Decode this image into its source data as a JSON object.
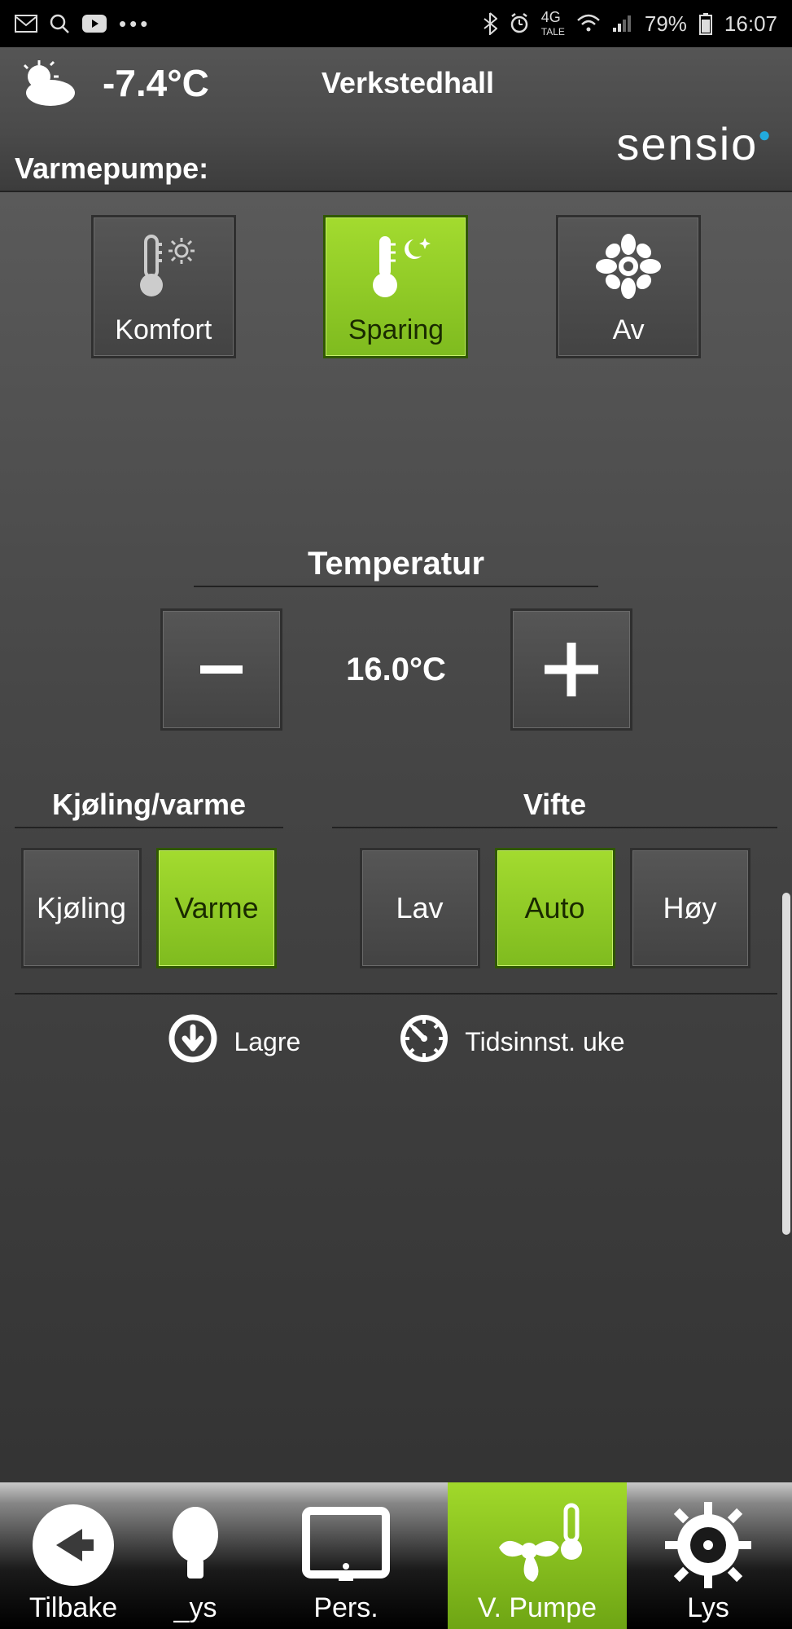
{
  "status": {
    "battery": "79%",
    "time": "16:07",
    "network_label": "4G",
    "network_sub": "TALE"
  },
  "header": {
    "outside_temp": "-7.4°C",
    "room_name": "Verkstedhall",
    "brand": "sensio",
    "section_title": "Varmepumpe:"
  },
  "modes": {
    "items": [
      {
        "label": "Komfort",
        "active": false
      },
      {
        "label": "Sparing",
        "active": true
      },
      {
        "label": "Av",
        "active": false
      }
    ]
  },
  "temperature": {
    "title": "Temperatur",
    "value": "16.0°C"
  },
  "heat_cool": {
    "title": "Kjøling/varme",
    "options": [
      {
        "label": "Kjøling",
        "active": false
      },
      {
        "label": "Varme",
        "active": true
      }
    ]
  },
  "fan": {
    "title": "Vifte",
    "options": [
      {
        "label": "Lav",
        "active": false
      },
      {
        "label": "Auto",
        "active": true
      },
      {
        "label": "Høy",
        "active": false
      }
    ]
  },
  "actions": {
    "save": "Lagre",
    "schedule": "Tidsinnst. uke"
  },
  "nav": {
    "items": [
      {
        "label": "Tilbake",
        "active": false
      },
      {
        "label": "_ys",
        "active": false
      },
      {
        "label": "Pers.",
        "active": false
      },
      {
        "label": "V. Pumpe",
        "active": true
      },
      {
        "label": "Lys",
        "active": false
      }
    ]
  },
  "colors": {
    "accent": "#8fcf22"
  }
}
